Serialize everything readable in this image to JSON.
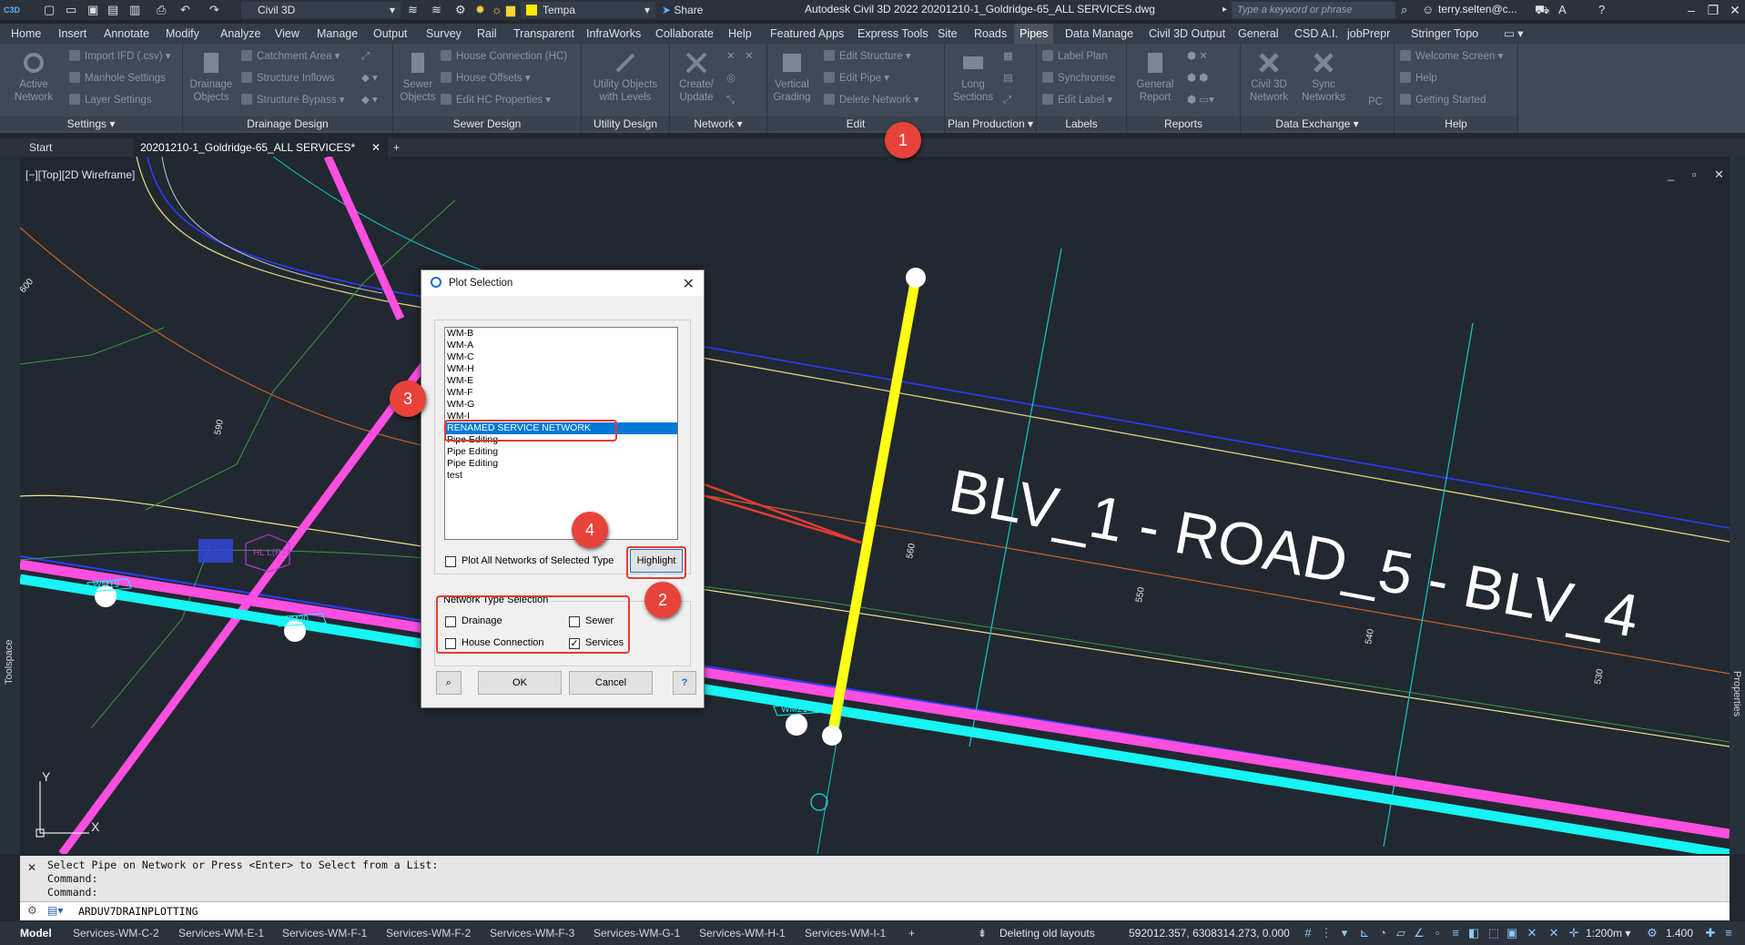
{
  "titlebar": {
    "logo": "C3D",
    "workspace": "Civil 3D",
    "layer": "Tempa",
    "share": "Share",
    "app_title": "Autodesk Civil 3D 2022    20201210-1_Goldridge-65_ALL SERVICES.dwg",
    "search_placeholder": "Type a keyword or phrase",
    "user": "terry.selten@c..."
  },
  "ribbon_tabs": [
    "Home",
    "Insert",
    "Annotate",
    "Modify",
    "Analyze",
    "View",
    "Manage",
    "Output",
    "Survey",
    "Rail",
    "Transparent",
    "InfraWorks",
    "Collaborate",
    "Help",
    "Featured Apps",
    "Express Tools",
    "Site",
    "Roads",
    "Pipes",
    "Data Manage",
    "Civil 3D Output",
    "General",
    "CSD A.I.",
    "jobPrepr",
    "Stringer Topo"
  ],
  "active_tab": "Pipes",
  "ribbon": {
    "settings": {
      "title": "Settings ▾",
      "big": "Active Network",
      "items": [
        "Import IFD (.csv) ▾",
        "Manhole Settings",
        "Layer Settings"
      ]
    },
    "drainage": {
      "title": "Drainage Design",
      "big": "Drainage Objects",
      "items": [
        "Catchment Area ▾",
        "Structure Inflows",
        "Structure Bypass ▾"
      ]
    },
    "sewer": {
      "title": "Sewer Design",
      "big": "Sewer Objects",
      "items": [
        "House Connection (HC)",
        "House Offsets ▾",
        "Edit HC Properties ▾"
      ]
    },
    "utility": {
      "title": "Utility Design",
      "big": "Utility Objects with Levels"
    },
    "network": {
      "title": "Network ▾",
      "big": "Create/ Update"
    },
    "edit": {
      "title": "Edit",
      "big": "Vertical Grading",
      "items": [
        "Edit Structure ▾",
        "Edit Pipe ▾",
        "Delete Network ▾"
      ]
    },
    "plan": {
      "title": "Plan Production ▾",
      "big": "Long Sections"
    },
    "labels": {
      "title": "Labels",
      "items": [
        "Label Plan",
        "Synchronise",
        "Edit Label ▾"
      ]
    },
    "reports": {
      "title": "Reports",
      "big": "General Report"
    },
    "dataexchange": {
      "title": "Data Exchange ▾",
      "big1": "Civil 3D Network",
      "big2": "Sync Networks",
      "pc": "PC"
    },
    "help": {
      "title": "Help",
      "items": [
        "Welcome Screen ▾",
        "Help",
        "Getting Started"
      ]
    }
  },
  "doc_tabs": {
    "start": "Start",
    "active": "20201210-1_Goldridge-65_ALL SERVICES*",
    "close": "✕",
    "add": "+"
  },
  "viewport": {
    "label": "[−][Top][2D Wireframe]",
    "controls": "_ ▫ ✕",
    "road_label": "BLV_1 - ROAD_5 - BLV_4",
    "contours": [
      "600",
      "590",
      "560",
      "550",
      "540",
      "530"
    ],
    "pipe_labels": [
      "WM19",
      "WM20",
      "WM21",
      "HL L(P2)"
    ],
    "axis_y": "Y",
    "axis_x": "X"
  },
  "side_panels": {
    "left": "Toolspace",
    "right": "Properties"
  },
  "dialog": {
    "title": "Plot Selection",
    "networks": [
      "WM-B",
      "WM-A",
      "WM-C",
      "WM-H",
      "WM-E",
      "WM-F",
      "WM-G",
      "WM-I",
      "RENAMED SERVICE NETWORK",
      "Pipe Editing",
      "Pipe Editing",
      "Pipe Editing",
      "test"
    ],
    "selected_network": "RENAMED SERVICE NETWORK",
    "plot_all_label": "Plot All Networks of Selected Type",
    "plot_all_checked": false,
    "highlight": "Highlight",
    "group_label": "Network Type Selection",
    "types": {
      "drainage": "Drainage",
      "sewer": "Sewer",
      "house": "House Connection",
      "services": "Services"
    },
    "types_checked": {
      "drainage": false,
      "sewer": false,
      "house": false,
      "services": true
    },
    "zoom_icon": "magnifier-icon",
    "ok": "OK",
    "cancel": "Cancel",
    "help_icon": "?"
  },
  "annotations": {
    "c1": "1",
    "c2": "2",
    "c3": "3",
    "c4": "4"
  },
  "command": {
    "history": [
      "Select Pipe on Network or Press <Enter> to Select from a List:",
      "Command:",
      "Command:"
    ],
    "input": "ARDUV7DRAINPLOTTING"
  },
  "statusbar": {
    "model": "Model",
    "layouts": [
      "Services-WM-C-2",
      "Services-WM-E-1",
      "Services-WM-F-1",
      "Services-WM-F-2",
      "Services-WM-F-3",
      "Services-WM-G-1",
      "Services-WM-H-1",
      "Services-WM-I-1"
    ],
    "add": "+",
    "message": "Deleting old layouts",
    "coords": "592012.357, 6308314.273, 0.000",
    "scale": "1:200m ▾",
    "lineweight": "1.400"
  },
  "colors": {
    "pipe_magenta": "#ff4fe0",
    "pipe_cyan": "#17f4f4",
    "pipe_yellow": "#ffff14",
    "annotation_red": "#e8433b",
    "selection_blue": "#0078d7"
  }
}
